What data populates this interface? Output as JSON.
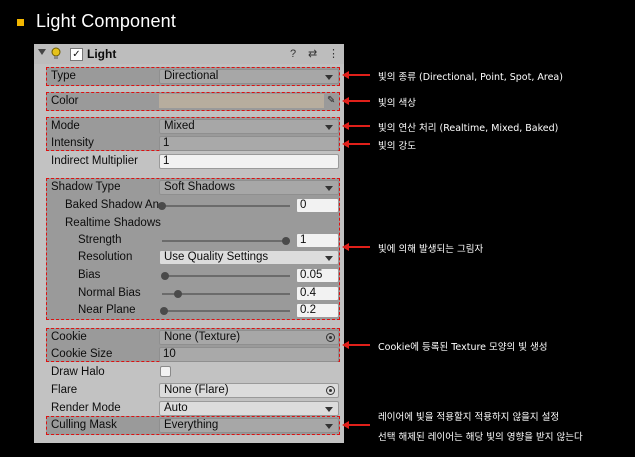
{
  "slide": {
    "title": "Light Component"
  },
  "component": {
    "name": "Light",
    "enabled_mark": "✓"
  },
  "header_icons": {
    "help": "?",
    "preset": "⇄",
    "menu": "⋮"
  },
  "fields": {
    "type": {
      "label": "Type",
      "value": "Directional"
    },
    "color": {
      "label": "Color",
      "value": "#b7ad9e"
    },
    "mode": {
      "label": "Mode",
      "value": "Mixed"
    },
    "intensity": {
      "label": "Intensity",
      "value": "1"
    },
    "indirect": {
      "label": "Indirect Multiplier",
      "value": "1"
    },
    "shadow_type": {
      "label": "Shadow Type",
      "value": "Soft Shadows"
    },
    "baked_shadow": {
      "label": "Baked Shadow An",
      "value": "0",
      "level": 0.0
    },
    "realtime_shadows": {
      "label": "Realtime Shadows"
    },
    "strength": {
      "label": "Strength",
      "value": "1",
      "level": 1.0
    },
    "resolution": {
      "label": "Resolution",
      "value": "Use Quality Settings"
    },
    "bias": {
      "label": "Bias",
      "value": "0.05",
      "level": 0.025
    },
    "normal_bias": {
      "label": "Normal Bias",
      "value": "0.4",
      "level": 0.13
    },
    "near_plane": {
      "label": "Near Plane",
      "value": "0.2",
      "level": 0.02
    },
    "cookie": {
      "label": "Cookie",
      "value": "None (Texture)"
    },
    "cookie_size": {
      "label": "Cookie Size",
      "value": "10"
    },
    "draw_halo": {
      "label": "Draw Halo",
      "checked": false
    },
    "flare": {
      "label": "Flare",
      "value": "None (Flare)"
    },
    "render_mode": {
      "label": "Render Mode",
      "value": "Auto"
    },
    "culling_mask": {
      "label": "Culling Mask",
      "value": "Everything"
    }
  },
  "annotations": {
    "type": "빛의 종류 (Directional, Point, Spot, Area)",
    "color": "빛의 색상",
    "mode": "빛의 연산 처리 (Realtime, Mixed, Baked)",
    "intensity": "빛의 강도",
    "shadow": "빛에 의해 발생되는 그림자",
    "cookie": "Cookie에 등록된 Texture 모양의 빛 생성",
    "culling_line1": "레이어에 빛을 적용할지 적용하지 않을지 설정",
    "culling_line2": "선택 해제된 레이어는 해당 빛의 영향을 받지 않는다"
  },
  "colors": {
    "accent_bullet": "#f2b600",
    "annotation_red": "#e0201a",
    "highlight_border": "#dd1111"
  }
}
